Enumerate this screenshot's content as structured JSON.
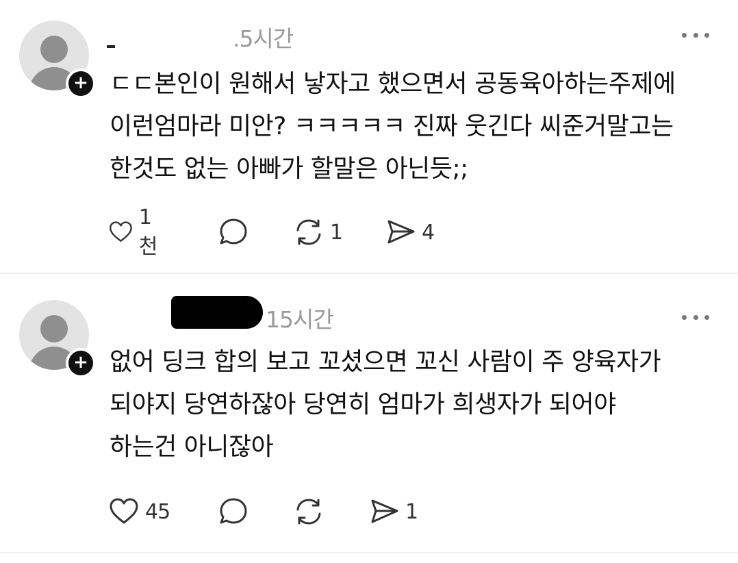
{
  "posts": [
    {
      "timestamp": ".5시간",
      "lines": [
        "ㄷㄷ본인이 원해서 낳자고 했으면서 공동육아하는주제에",
        "이런엄마라 미안? ㅋㅋㅋㅋㅋ 진짜 웃긴다 씨준거말고는",
        "한것도 없는 아빠가 할말은 아닌듯;;"
      ],
      "likes": "1천",
      "comments": "",
      "reposts": "1",
      "shares": "4"
    },
    {
      "timestamp": "15시간",
      "lines": [
        "없어 딩크 합의 보고 꼬셨으면 꼬신 사람이 주 양육자가",
        "되야지 당연하잖아 당연히 엄마가 희생자가 되어야",
        "하는건 아니잖아"
      ],
      "likes": "45",
      "comments": "",
      "reposts": "",
      "shares": "1"
    }
  ],
  "icons": {
    "like": "heart-icon",
    "comment": "comment-icon",
    "repost": "repost-icon",
    "share": "send-icon",
    "more": "more-icon",
    "follow": "plus-icon"
  },
  "colors": {
    "text": "#111111",
    "muted": "#9a9a9a",
    "icon": "#333333",
    "divider": "#eeeeee"
  }
}
